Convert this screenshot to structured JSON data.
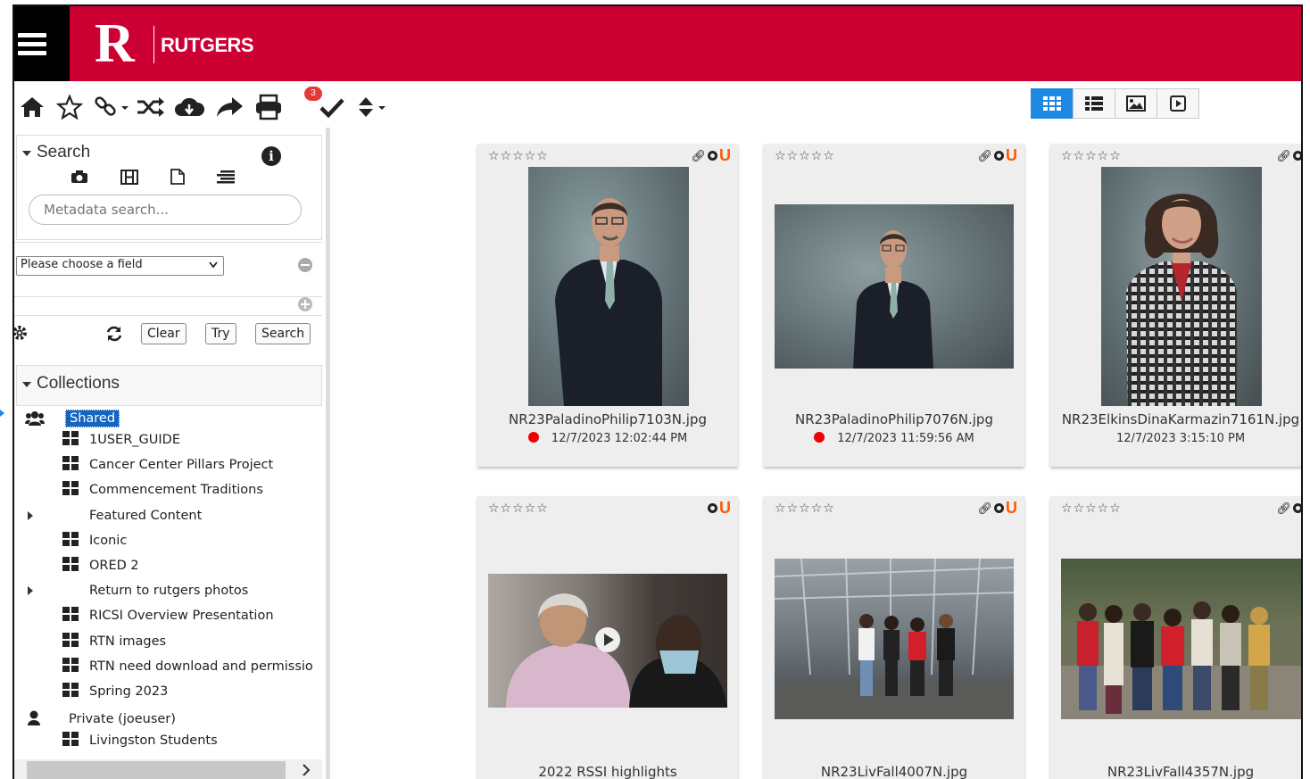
{
  "brand": {
    "letter": "R",
    "name": "RUTGERS"
  },
  "toolbar": {
    "badge": "3"
  },
  "search": {
    "title": "Search",
    "placeholder": "Metadata search...",
    "field_select": "Please choose a field",
    "clear": "Clear",
    "try": "Try",
    "search": "Search"
  },
  "collections": {
    "title": "Collections",
    "shared": "Shared",
    "items": [
      "1USER_GUIDE",
      "Cancer Center Pillars Project",
      "Commencement Traditions",
      "Featured Content",
      "Iconic",
      "ORED 2",
      "Return to rutgers photos",
      "RICSI Overview Presentation",
      "RTN images",
      "RTN need download and permissio",
      "Spring 2023"
    ],
    "private": "Private (joeuser)",
    "private_items": [
      "Livingston Students"
    ]
  },
  "cards": [
    {
      "filename": "NR23PaladinoPhilip7103N.jpg",
      "date": "12/7/2023 12:02:44 PM",
      "stars": "☆☆☆☆☆"
    },
    {
      "filename": "NR23PaladinoPhilip7076N.jpg",
      "date": "12/7/2023 11:59:56 AM",
      "stars": "☆☆☆☆☆"
    },
    {
      "filename": "NR23ElkinsDinaKarmazin7161N.jpg",
      "date": "12/7/2023 3:15:10 PM",
      "stars": "☆☆☆☆☆"
    },
    {
      "filename": "2022 RSSI highlights",
      "date": "",
      "stars": "☆☆☆☆☆"
    },
    {
      "filename": "NR23LivFall4007N.jpg",
      "date": "",
      "stars": "☆☆☆☆☆"
    },
    {
      "filename": "NR23LivFall4357N.jpg",
      "date": "",
      "stars": "☆☆☆☆☆"
    }
  ],
  "colors": {
    "brand_red": "#cc0033",
    "active_view": "#1e88e5",
    "status_dot": "#e00000",
    "orange_u": "#ff5a00"
  }
}
